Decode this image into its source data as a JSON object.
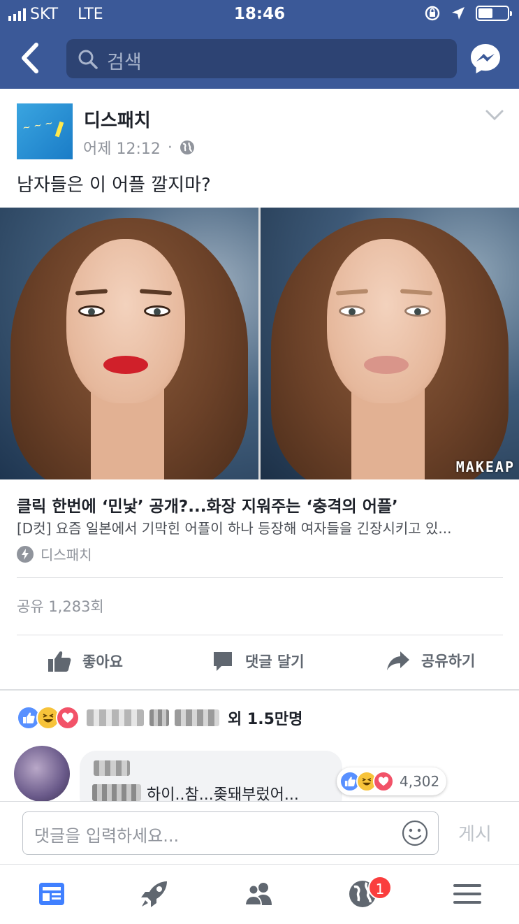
{
  "status_bar": {
    "carrier": "SKT",
    "network": "LTE",
    "time": "18:46"
  },
  "navbar": {
    "search_placeholder": "검색"
  },
  "post": {
    "page_name": "디스패치",
    "timestamp": "어제 12:12",
    "separator": "·",
    "text": "남자들은 이 어플 깔지마?",
    "image_watermark": "MAKEAP",
    "link": {
      "title": "클릭 한번에 ‘민낯’ 공개?...화장 지워주는 ‘충격의 어플’",
      "description": "[D컷] 요즘 일본에서 기막힌 어플이 하나 등장해 여자들을 긴장시키고 있...",
      "source": "디스패치"
    },
    "shares": "공유 1,283회"
  },
  "actions": {
    "like": "좋아요",
    "comment": "댓글 달기",
    "share": "공유하기"
  },
  "reactions": {
    "summary_suffix": "외 1.5만명",
    "icons": [
      "like-icon",
      "haha-icon",
      "love-icon"
    ]
  },
  "comment": {
    "text": "하이..참...좆돼부렀어...",
    "reaction_count": "4,302"
  },
  "composer": {
    "placeholder": "댓글을 입력하세요...",
    "post_label": "게시"
  },
  "tabbar": {
    "notification_badge": "1"
  },
  "colors": {
    "brand": "#3b5998",
    "like": "#5890ff",
    "love": "#f25268",
    "haha": "#f7c33a",
    "badge": "#fa3e3e"
  }
}
